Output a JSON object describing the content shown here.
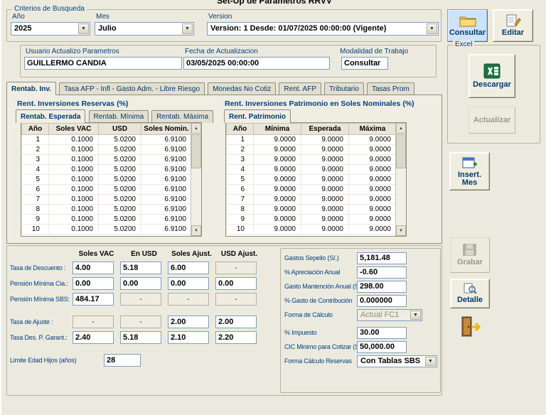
{
  "window": {
    "title": "Set-Up de Parametros RRVV"
  },
  "colors": {
    "accent_blue": "#cfe3f8",
    "label_navy": "#004080",
    "excel_green": "#1e7145",
    "window_bg": "#eceade"
  },
  "criteria": {
    "group_label": "Criterios de Busqueda",
    "year_label": "Año",
    "year_value": "2025",
    "month_label": "Mes",
    "month_value": "Julio",
    "version_label": "Version",
    "version_value": "Version: 1  Desde: 01/07/2025 00:00:00 (Vigente)"
  },
  "header_fields": {
    "user_label": "Usuario Actualizo Parametros",
    "user_value": "GUILLERMO CANDIA",
    "date_label": "Fecha de Actualizacion",
    "date_value": "03/05/2025 00:00:00",
    "mode_label": "Modalidad de Trabajo",
    "mode_value": "Consultar"
  },
  "side_buttons": {
    "consultar": "Consultar",
    "editar": "Editar",
    "excel_group": "Excel",
    "descargar": "Descargar",
    "actualizar": "Actualizar",
    "insert_mes": "Insert. Mes",
    "grabar": "Grabar",
    "detalle": "Detalle"
  },
  "main_tabs": [
    "Rentab. Inv.",
    "Tasa AFP - Infl - Gasto Adm. - Libre Riesgo",
    "Monedas No Cotiz",
    "Rent. AFP",
    "Tributario",
    "Tasas Prom"
  ],
  "reserves": {
    "title": "Rent. Inversiones Reservas (%)",
    "tabs": [
      "Rentab. Esperada",
      "Rentab. Mínima",
      "Rentab. Máxima"
    ],
    "headers": [
      "Año",
      "Soles VAC",
      "USD",
      "Soles Nomin."
    ],
    "rows": [
      [
        "1",
        "0.1000",
        "5.0200",
        "6.9100"
      ],
      [
        "2",
        "0.1000",
        "5.0200",
        "6.9100"
      ],
      [
        "3",
        "0.1000",
        "5.0200",
        "6.9100"
      ],
      [
        "4",
        "0.1000",
        "5.0200",
        "6.9100"
      ],
      [
        "5",
        "0.1000",
        "5.0200",
        "6.9100"
      ],
      [
        "6",
        "0.1000",
        "5.0200",
        "6.9100"
      ],
      [
        "7",
        "0.1000",
        "5.0200",
        "6.9100"
      ],
      [
        "8",
        "0.1000",
        "5.0200",
        "6.9100"
      ],
      [
        "9",
        "0.1000",
        "5.0200",
        "6.9100"
      ],
      [
        "10",
        "0.1000",
        "5.0200",
        "6.9100"
      ]
    ]
  },
  "patrimonio": {
    "title": "Rent. Inversiones Patrimonio en Soles Nominales (%)",
    "tabs": [
      "Rent. Patrimonio"
    ],
    "headers": [
      "Año",
      "Mínima",
      "Esperada",
      "Máxima"
    ],
    "rows": [
      [
        "1",
        "9.0000",
        "9.0000",
        "9.0000"
      ],
      [
        "2",
        "9.0000",
        "9.0000",
        "9.0000"
      ],
      [
        "3",
        "9.0000",
        "9.0000",
        "9.0000"
      ],
      [
        "4",
        "9.0000",
        "9.0000",
        "9.0000"
      ],
      [
        "5",
        "9.0000",
        "9.0000",
        "9.0000"
      ],
      [
        "6",
        "9.0000",
        "9.0000",
        "9.0000"
      ],
      [
        "7",
        "9.0000",
        "9.0000",
        "9.0000"
      ],
      [
        "8",
        "9.0000",
        "9.0000",
        "9.0000"
      ],
      [
        "9",
        "9.0000",
        "9.0000",
        "9.0000"
      ],
      [
        "10",
        "9.0000",
        "9.0000",
        "9.0000"
      ]
    ]
  },
  "rates_matrix": {
    "col_headers": [
      "Soles VAC",
      "En USD",
      "Soles Ajust.",
      "USD Ajust."
    ],
    "rows": [
      {
        "label": "Tasa de Descuento :",
        "values": [
          "4.00",
          "5.18",
          "6.00",
          "-"
        ]
      },
      {
        "label": "Pensión Mínima Cia.:",
        "values": [
          "0.00",
          "0.00",
          "0.00",
          "0.00"
        ]
      },
      {
        "label": "Pensión Mínima SBS:",
        "values": [
          "484.17",
          "-",
          "-",
          "-"
        ]
      },
      {
        "label": "Tasa de Ajuste :",
        "values": [
          "-",
          "-",
          "2.00",
          "2.00"
        ],
        "gap": true
      },
      {
        "label": "Tasa Des. P. Garant.:",
        "values": [
          "2.40",
          "5.18",
          "2.10",
          "2.20"
        ]
      }
    ],
    "limite_label": "Limite Edad Hijos (años)",
    "limite_value": "28"
  },
  "params_panel": {
    "fields": [
      {
        "label": "Gastos Sepelio (S/.)",
        "value": "5,181.48",
        "kind": "input"
      },
      {
        "label": "% Apreciación Anual",
        "value": "-0.60",
        "kind": "input"
      },
      {
        "label": "Gasto Mantención Anual (S/.)",
        "value": "298.00",
        "kind": "input"
      },
      {
        "label": "% Gasto de Contribución",
        "value": "0.000000",
        "kind": "input"
      },
      {
        "label": "Forma de Cálculo",
        "value": "Actual FC1",
        "kind": "select_disabled"
      },
      {
        "label": "% Impuesto",
        "value": "30.00",
        "kind": "input",
        "gap": true
      },
      {
        "label": "CIC Minimo para Cotizar (S/.)",
        "value": "50,000.00",
        "kind": "input"
      },
      {
        "label": "Forma Cálculo Reservas",
        "value": "Con Tablas SBS",
        "kind": "select"
      }
    ]
  }
}
